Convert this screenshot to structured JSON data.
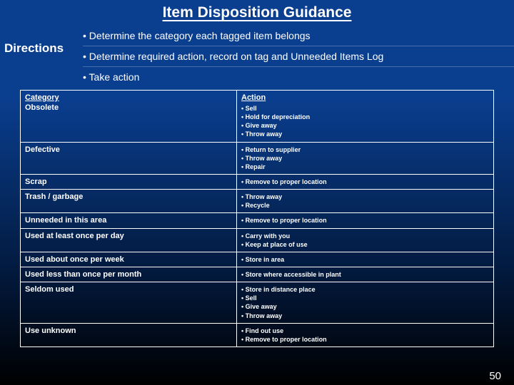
{
  "title": "Item Disposition Guidance",
  "directions_label": "Directions",
  "directions": [
    "• Determine the category each tagged item belongs",
    "• Determine required action, record on tag and Unneeded Items Log",
    "• Take action"
  ],
  "table": {
    "header": {
      "category": "Category",
      "action": "Action"
    },
    "rows": [
      {
        "category": "Obsolete",
        "actions": [
          "• Sell",
          "• Hold for depreciation",
          "• Give away",
          "• Throw away"
        ]
      },
      {
        "category": "Defective",
        "actions": [
          "• Return to supplier",
          "• Throw away",
          "• Repair"
        ]
      },
      {
        "category": "Scrap",
        "actions": [
          "• Remove to proper location"
        ]
      },
      {
        "category": "Trash / garbage",
        "actions": [
          "• Throw away",
          "• Recycle"
        ]
      },
      {
        "category": "Unneeded in this area",
        "actions": [
          "• Remove to proper location"
        ]
      },
      {
        "category": "Used at least once per day",
        "actions": [
          "• Carry with you",
          "• Keep at place of use"
        ]
      },
      {
        "category": "Used about once per week",
        "actions": [
          "• Store in area"
        ]
      },
      {
        "category": "Used less than once per month",
        "actions": [
          "• Store where accessible in plant"
        ]
      },
      {
        "category": "Seldom used",
        "actions": [
          "• Store in distance place",
          "• Sell",
          "• Give away",
          "• Throw away"
        ]
      },
      {
        "category": "Use unknown",
        "actions": [
          "• Find out use",
          "• Remove to proper location"
        ]
      }
    ]
  },
  "page_number": "50"
}
